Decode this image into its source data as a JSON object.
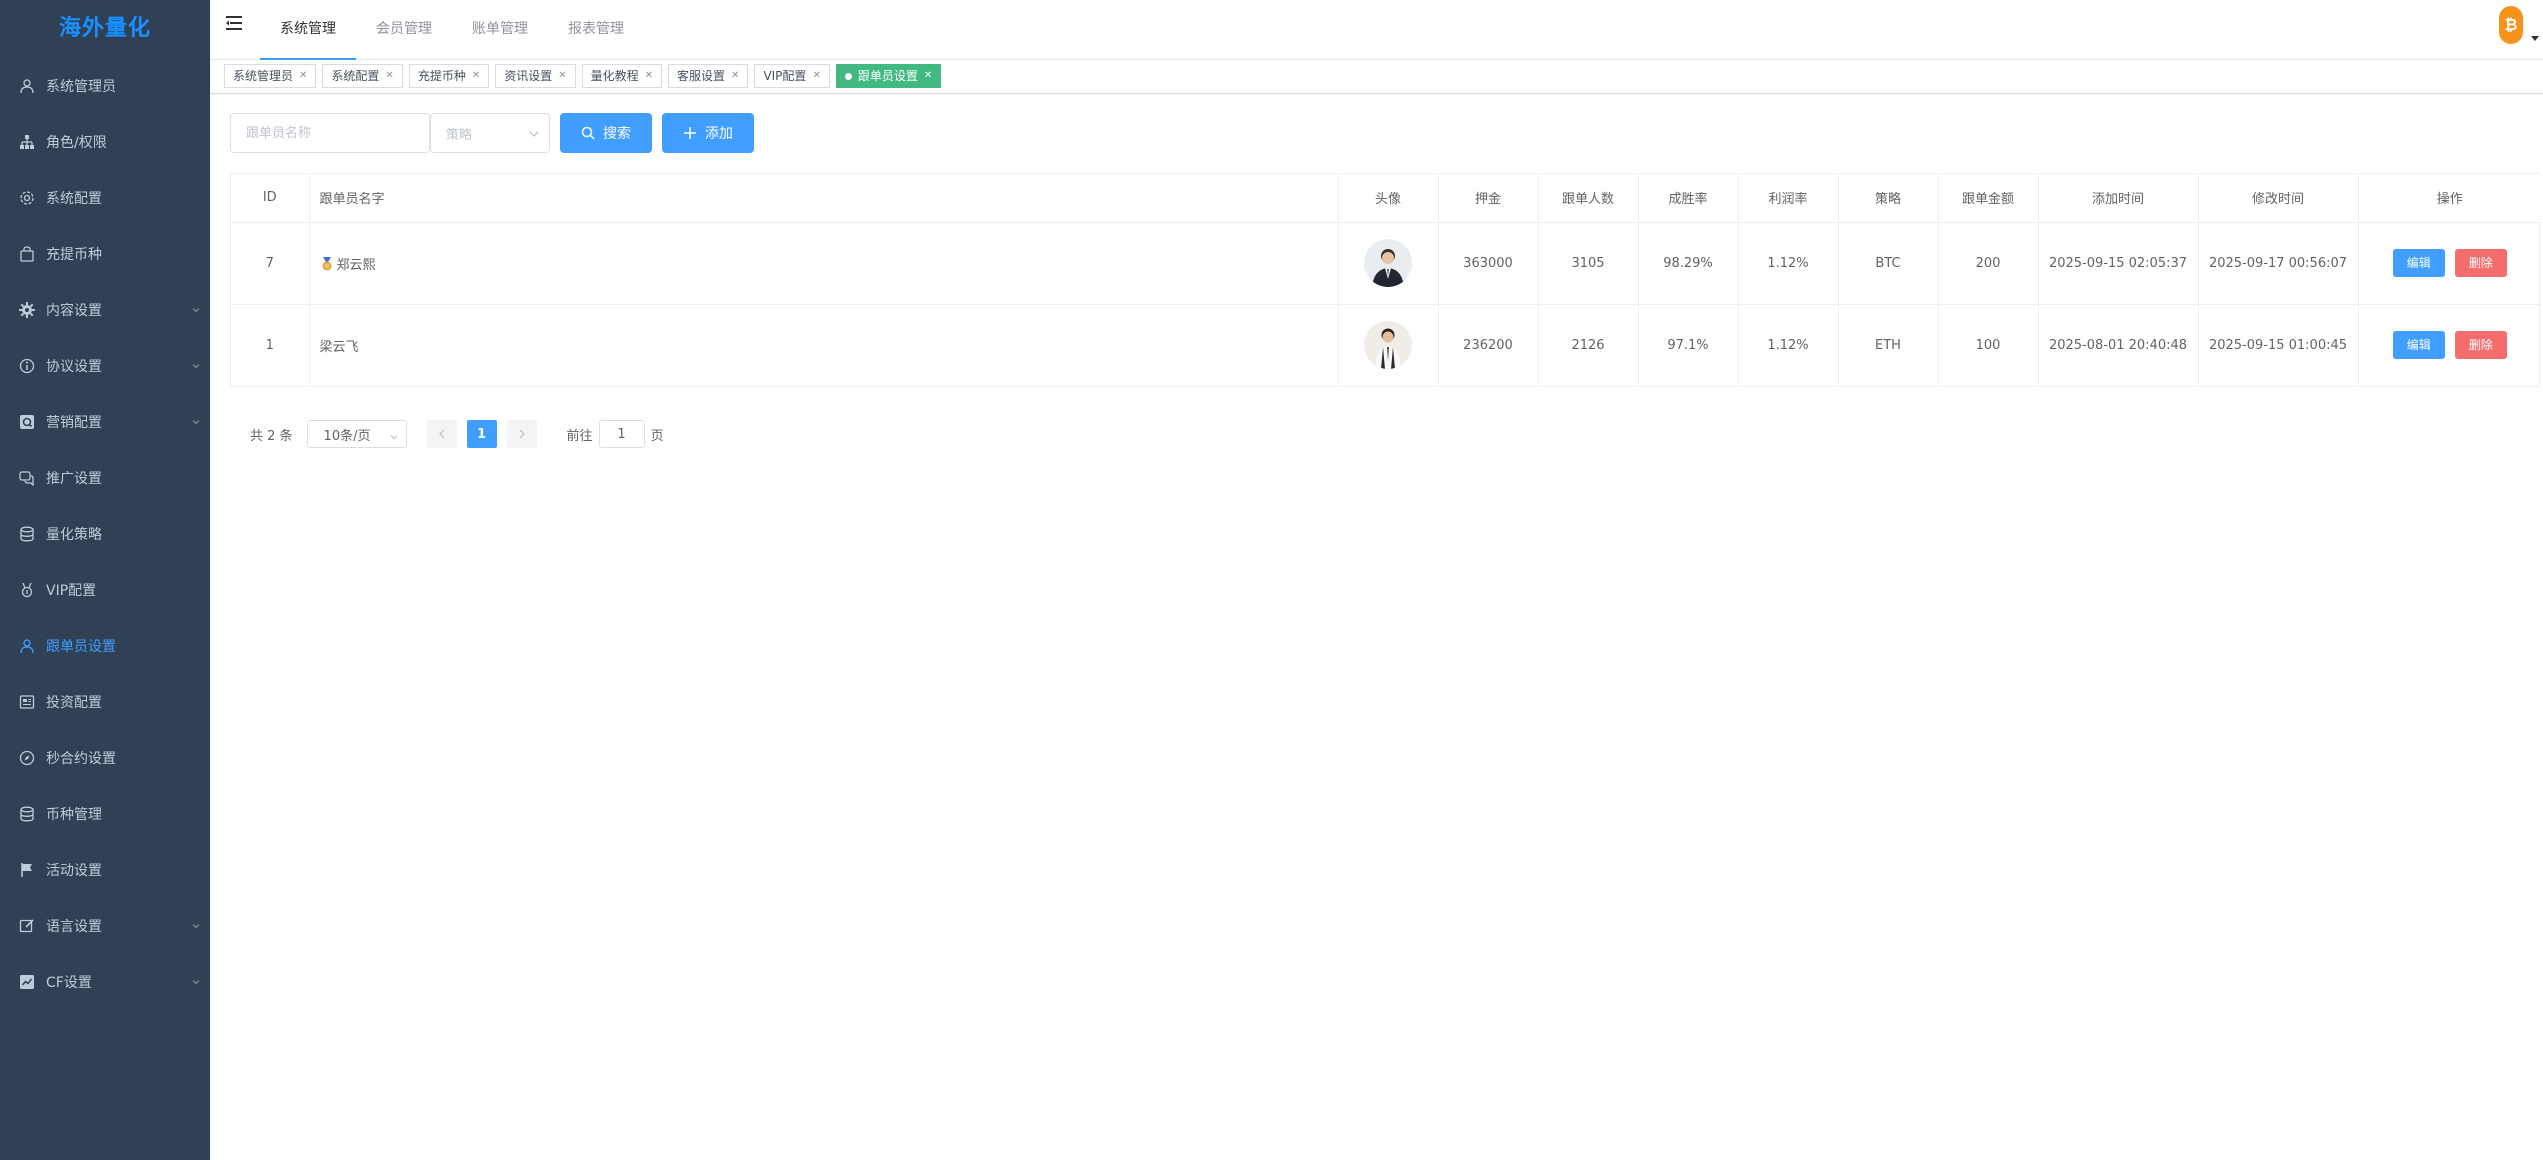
{
  "brand": "海外量化",
  "sidebar": {
    "items": [
      {
        "label": "系统管理员",
        "icon": "user-icon",
        "arrow": false,
        "active": false
      },
      {
        "label": "角色/权限",
        "icon": "tree-icon",
        "arrow": false,
        "active": false
      },
      {
        "label": "系统配置",
        "icon": "gear-icon",
        "arrow": false,
        "active": false
      },
      {
        "label": "充提币种",
        "icon": "bag-icon",
        "arrow": false,
        "active": false
      },
      {
        "label": "内容设置",
        "icon": "cog-icon",
        "arrow": true,
        "active": false
      },
      {
        "label": "协议设置",
        "icon": "info-icon",
        "arrow": true,
        "active": false
      },
      {
        "label": "营销配置",
        "icon": "tag-icon",
        "arrow": true,
        "active": false
      },
      {
        "label": "推广设置",
        "icon": "chat-icon",
        "arrow": false,
        "active": false
      },
      {
        "label": "量化策略",
        "icon": "database-icon",
        "arrow": false,
        "active": false
      },
      {
        "label": "VIP配置",
        "icon": "medal-icon",
        "arrow": false,
        "active": false
      },
      {
        "label": "跟单员设置",
        "icon": "user-icon",
        "arrow": false,
        "active": true
      },
      {
        "label": "投资配置",
        "icon": "news-icon",
        "arrow": false,
        "active": false
      },
      {
        "label": "秒合约设置",
        "icon": "compass-icon",
        "arrow": false,
        "active": false
      },
      {
        "label": "币种管理",
        "icon": "database-icon",
        "arrow": false,
        "active": false
      },
      {
        "label": "活动设置",
        "icon": "flag-icon",
        "arrow": false,
        "active": false
      },
      {
        "label": "语言设置",
        "icon": "edit-icon",
        "arrow": true,
        "active": false
      },
      {
        "label": "CF设置",
        "icon": "chart-icon",
        "arrow": true,
        "active": false
      }
    ]
  },
  "topnav": [
    "系统管理",
    "会员管理",
    "账单管理",
    "报表管理"
  ],
  "tags": [
    {
      "label": "系统管理员",
      "active": false
    },
    {
      "label": "系统配置",
      "active": false
    },
    {
      "label": "充提币种",
      "active": false
    },
    {
      "label": "资讯设置",
      "active": false
    },
    {
      "label": "量化教程",
      "active": false
    },
    {
      "label": "客服设置",
      "active": false
    },
    {
      "label": "VIP配置",
      "active": false
    },
    {
      "label": "跟单员设置",
      "active": true
    }
  ],
  "filters": {
    "name_placeholder": "跟单员名称",
    "strategy_placeholder": "策略",
    "search_label": "搜索",
    "add_label": "添加"
  },
  "table": {
    "headers": [
      "ID",
      "跟单员名字",
      "头像",
      "押金",
      "跟单人数",
      "成胜率",
      "利润率",
      "策略",
      "跟单金额",
      "添加时间",
      "修改时间",
      "操作"
    ],
    "rows": [
      {
        "id": "7",
        "name": "郑云熙",
        "deposit": "363000",
        "followers": "3105",
        "win_rate": "98.29%",
        "profit_rate": "1.12%",
        "strategy": "BTC",
        "amount": "200",
        "created": "2025-09-15 02:05:37",
        "updated": "2025-09-17 00:56:07"
      },
      {
        "id": "1",
        "name": "梁云飞",
        "deposit": "236200",
        "followers": "2126",
        "win_rate": "97.1%",
        "profit_rate": "1.12%",
        "strategy": "ETH",
        "amount": "100",
        "created": "2025-08-01 20:40:48",
        "updated": "2025-09-15 01:00:45"
      }
    ],
    "edit_label": "编辑",
    "delete_label": "删除"
  },
  "pagination": {
    "total": "共 2 条",
    "page_size": "10条/页",
    "current": "1",
    "goto_label": "前往",
    "goto_value": "1",
    "page_suffix": "页"
  },
  "colors": {
    "sidebar_bg": "#304156",
    "primary": "#409eff",
    "danger": "#f56c6c",
    "tag_active": "#42b983"
  }
}
